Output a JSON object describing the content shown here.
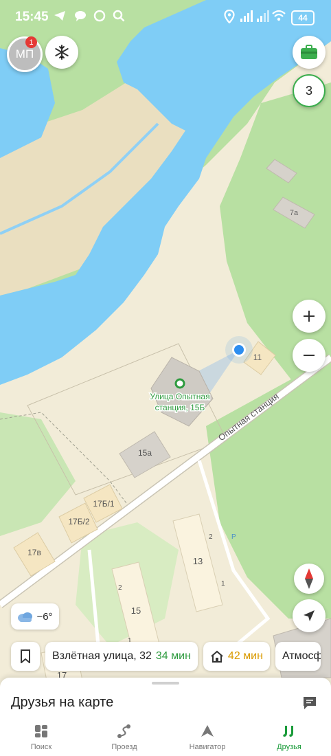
{
  "status_bar": {
    "time": "15:45",
    "battery": "44"
  },
  "top_controls": {
    "avatar_initials": "МП",
    "avatar_badge": "1",
    "layers_count": "3"
  },
  "map": {
    "buildings": [
      "7а",
      "11",
      "15а",
      "17Б/1",
      "17Б/2",
      "17в",
      "13",
      "15",
      "17"
    ],
    "entrances": [
      "2",
      "1",
      "2",
      "1"
    ],
    "parking_symbol": "P",
    "street_label": "Опытная станция",
    "selected_place": {
      "line1": "Улица Опытная",
      "line2": "станция, 15Б"
    }
  },
  "weather": {
    "temperature": "−6°"
  },
  "quick_routes": [
    {
      "label": "Взлётная улица, 32",
      "eta": "34 мин"
    },
    {
      "label": "",
      "eta": "42 мин"
    },
    {
      "label": "Атмосф",
      "eta": ""
    }
  ],
  "sheet": {
    "title": "Друзья на карте"
  },
  "tabs": [
    {
      "label": "Поиск",
      "icon": "search-grid-icon"
    },
    {
      "label": "Проезд",
      "icon": "route-icon"
    },
    {
      "label": "Навигатор",
      "icon": "navigator-icon"
    },
    {
      "label": "Друзья",
      "icon": "friends-icon"
    }
  ],
  "colors": {
    "water": "#7fcdf6",
    "park": "#b8e0a2",
    "ground": "#f2ecd8",
    "building": "#d6d2cb",
    "accent_green": "#2e9b3f",
    "location_blue": "#2d8ef0"
  }
}
